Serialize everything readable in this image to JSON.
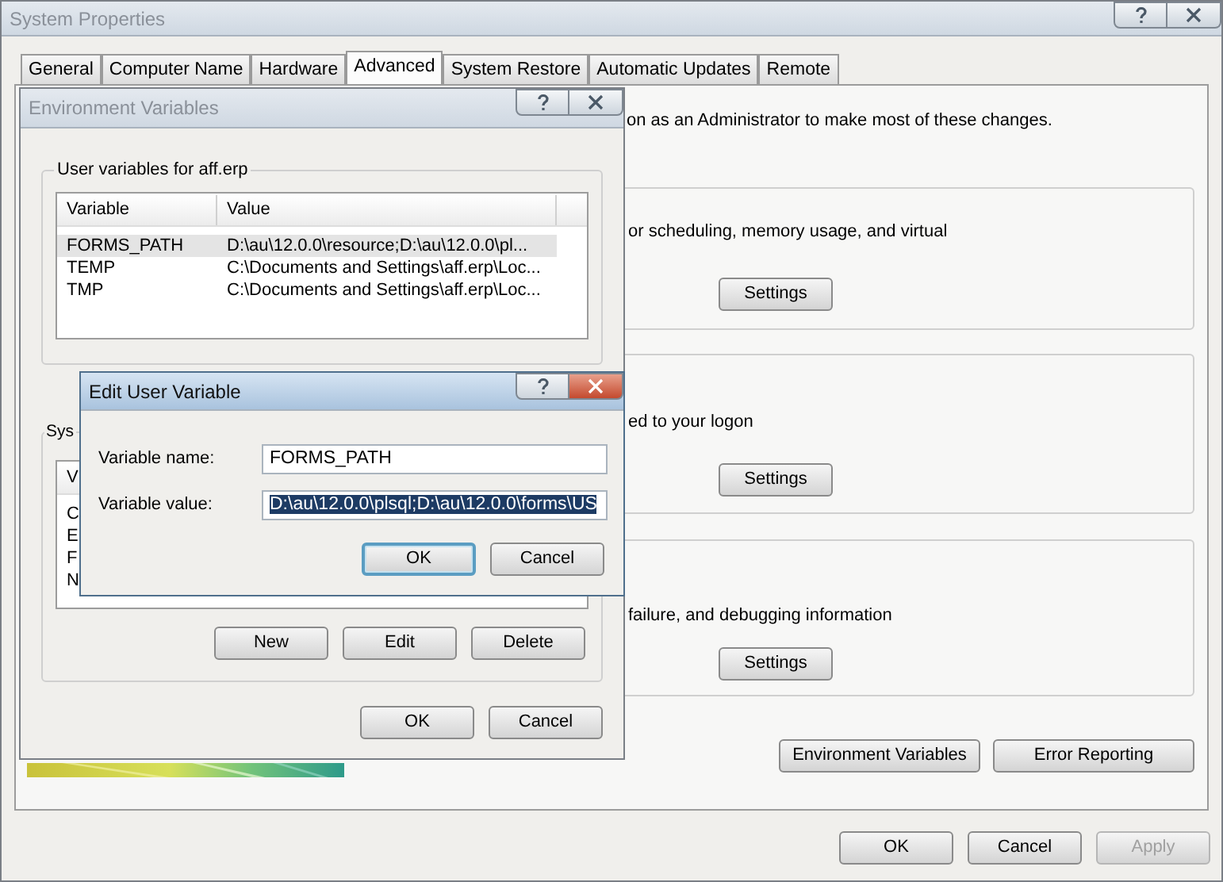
{
  "system_properties": {
    "title": "System Properties",
    "active": false,
    "tabs": [
      {
        "label": "General",
        "selected": false
      },
      {
        "label": "Computer Name",
        "selected": false
      },
      {
        "label": "Hardware",
        "selected": false
      },
      {
        "label": "Advanced",
        "selected": true
      },
      {
        "label": "System Restore",
        "selected": false
      },
      {
        "label": "Automatic Updates",
        "selected": false
      },
      {
        "label": "Remote",
        "selected": false
      }
    ],
    "admin_note": "on as an Administrator to make most of these changes.",
    "groups": [
      {
        "text": "or scheduling, memory usage, and virtual",
        "button": "Settings"
      },
      {
        "text": "ed to your logon",
        "button": "Settings"
      },
      {
        "text": "failure, and debugging information",
        "button": "Settings"
      }
    ],
    "panel_buttons": [
      "Environment Variables",
      "Error Reporting"
    ],
    "buttons": [
      {
        "label": "OK",
        "disabled": false
      },
      {
        "label": "Cancel",
        "disabled": false
      },
      {
        "label": "Apply",
        "disabled": true
      }
    ]
  },
  "environment_variables": {
    "title": "Environment Variables",
    "active": false,
    "user_group": {
      "label": "User variables for aff.erp",
      "columns": [
        "Variable",
        "Value"
      ],
      "rows": [
        {
          "variable": "FORMS_PATH",
          "value": "D:\\au\\12.0.0\\resource;D:\\au\\12.0.0\\pl...",
          "selected": true
        },
        {
          "variable": "TEMP",
          "value": "C:\\Documents and Settings\\aff.erp\\Loc...",
          "selected": false
        },
        {
          "variable": "TMP",
          "value": "C:\\Documents and Settings\\aff.erp\\Loc...",
          "selected": false
        }
      ]
    },
    "system_group": {
      "label": "Sys",
      "columns": [
        "V"
      ],
      "rows": [
        "C",
        "E",
        "F",
        "N"
      ]
    },
    "system_buttons": [
      "New",
      "Edit",
      "Delete"
    ],
    "buttons": [
      "OK",
      "Cancel"
    ]
  },
  "edit_user_variable": {
    "title": "Edit User Variable",
    "active": true,
    "fields": [
      {
        "label": "Variable name:",
        "value": "FORMS_PATH",
        "text_selected": false
      },
      {
        "label": "Variable value:",
        "value": "D:\\au\\12.0.0\\plsql;D:\\au\\12.0.0\\forms\\US",
        "text_selected": true
      }
    ],
    "buttons": [
      {
        "label": "OK",
        "default": true
      },
      {
        "label": "Cancel",
        "default": false
      }
    ]
  }
}
